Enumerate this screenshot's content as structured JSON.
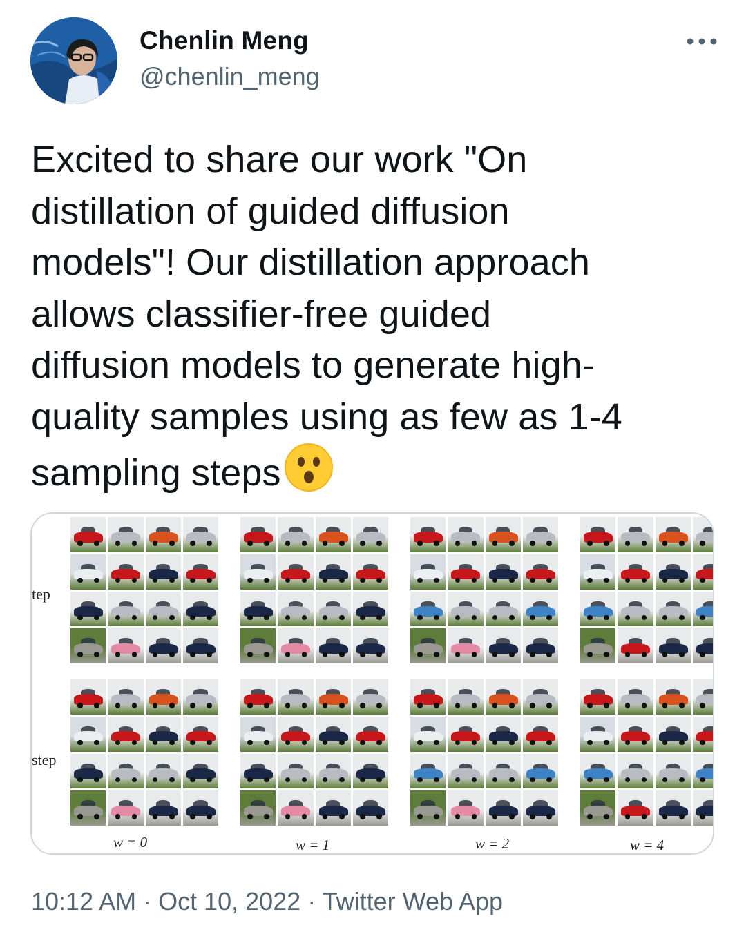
{
  "author": {
    "display_name": "Chenlin Meng",
    "handle": "@chenlin_meng",
    "avatar_icon": "profile-photo"
  },
  "menu": {
    "icon": "more-horizontal-icon"
  },
  "tweet": {
    "lines": [
      "Excited to share our work \"On",
      "distillation of guided diffusion",
      "models\"! Our distillation approach",
      "allows classifier-free guided",
      "diffusion models to generate high-",
      "quality samples using as few as 1-4",
      "sampling steps"
    ],
    "emoji": "astonished-face-emoji"
  },
  "media": {
    "row_labels": [
      "tep",
      "step"
    ],
    "w_labels": [
      "w = 0",
      "w = 1",
      "w = 2",
      "w = 4"
    ],
    "colors": {
      "red": "#c8171b",
      "orange": "#d9521e",
      "navy": "#1a2747",
      "silver": "#b8bcc2",
      "blue": "#3c82c4",
      "white": "#eceff1",
      "pink": "#e58aa6",
      "black": "#161616",
      "grass": "#5e7d3a",
      "road": "#9a9a92"
    }
  },
  "meta": {
    "time": "10:12 AM",
    "sep1": " · ",
    "date": "Oct 10, 2022",
    "sep2": " · ",
    "source": "Twitter Web App"
  },
  "theme": {
    "text_primary": "#0f1419",
    "text_secondary": "#536471",
    "border": "#cfd9de"
  }
}
